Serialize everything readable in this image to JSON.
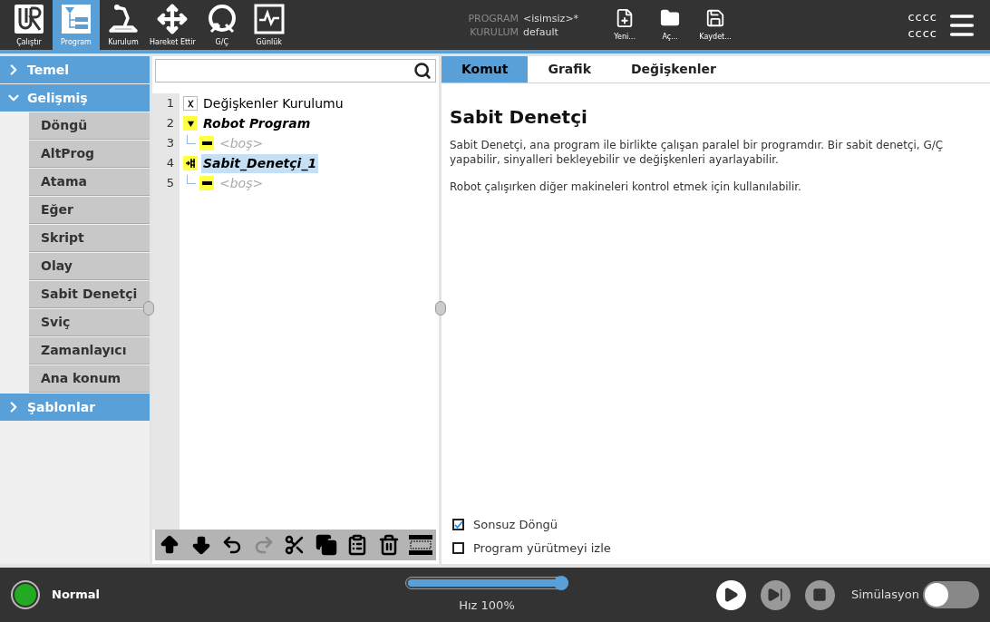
{
  "nav": [
    {
      "kind": "run",
      "label": "Çalıştır",
      "selected": false
    },
    {
      "kind": "program",
      "label": "Program",
      "selected": true
    },
    {
      "kind": "installation",
      "label": "Kurulum",
      "selected": false
    },
    {
      "kind": "move",
      "label": "Hareket Ettir",
      "selected": false
    },
    {
      "kind": "io",
      "label": "G/Ç",
      "selected": false
    },
    {
      "kind": "log",
      "label": "Günlük",
      "selected": false
    }
  ],
  "file_info": {
    "program_label": "PROGRAM",
    "program_value": "<isimsiz>*",
    "installation_label": "KURULUM",
    "installation_value": "default"
  },
  "file_actions": [
    {
      "kind": "new",
      "label": "Yeni..."
    },
    {
      "kind": "open",
      "label": "Aç..."
    },
    {
      "kind": "save",
      "label": "Kaydet..."
    }
  ],
  "user": {
    "line1": "cccc",
    "line2": "cccc"
  },
  "sidebar": [
    {
      "label": "Temel",
      "expanded": false
    },
    {
      "label": "Gelişmiş",
      "expanded": true,
      "children": [
        {
          "label": "Döngü"
        },
        {
          "label": "AltProg"
        },
        {
          "label": "Atama"
        },
        {
          "label": "Eğer"
        },
        {
          "label": "Skript"
        },
        {
          "label": "Olay"
        },
        {
          "label": "Sabit Denetçi"
        },
        {
          "label": "Sviç"
        },
        {
          "label": "Zamanlayıcı"
        },
        {
          "label": "Ana konum"
        }
      ]
    },
    {
      "label": "Şablonlar",
      "expanded": false
    }
  ],
  "tree": [
    {
      "line": "1",
      "kind": "variables",
      "label": "Değişkenler Kurulumu",
      "selected": false
    },
    {
      "line": "2",
      "kind": "program",
      "label": "Robot Program",
      "selected": false,
      "children": [
        {
          "line": "3",
          "kind": "empty",
          "label": "<boş>",
          "selected": false
        }
      ]
    },
    {
      "line": "4",
      "kind": "thread",
      "label": "Sabit_Denetçi_1",
      "selected": true,
      "children": [
        {
          "line": "5",
          "kind": "empty",
          "label": "<boş>",
          "selected": false
        }
      ]
    }
  ],
  "tree_toolbar": [
    {
      "kind": "up",
      "disabled": false
    },
    {
      "kind": "down",
      "disabled": false
    },
    {
      "kind": "undo",
      "disabled": false
    },
    {
      "kind": "redo",
      "disabled": true
    },
    {
      "kind": "cut",
      "disabled": false
    },
    {
      "kind": "copy",
      "disabled": false
    },
    {
      "kind": "paste",
      "disabled": false
    },
    {
      "kind": "delete",
      "disabled": false
    },
    {
      "kind": "suppress",
      "disabled": false
    }
  ],
  "tabs": [
    {
      "label": "Komut",
      "selected": true
    },
    {
      "label": "Grafik",
      "selected": false
    },
    {
      "label": "Değişkenler",
      "selected": false
    }
  ],
  "content": {
    "title": "Sabit Denetçi",
    "paragraphs": [
      "Sabit Denetçi, ana program ile birlikte çalışan paralel bir programdır. Bir sabit denetçi, G/Ç yapabilir, sinyalleri bekleyebilir ve değişkenleri ayarlayabilir.",
      "Robot çalışırken diğer makineleri kontrol etmek için kullanılabilir."
    ]
  },
  "options": [
    {
      "label": "Sonsuz Döngü",
      "checked": true
    },
    {
      "label": "Program yürütmeyi izle",
      "checked": false
    }
  ],
  "status": {
    "label": "Normal",
    "color": "#22aa22"
  },
  "speed": {
    "level": 1.0,
    "reading": "Hız 100%"
  },
  "controls": [
    {
      "kind": "play",
      "disabled": false
    },
    {
      "kind": "step",
      "disabled": true
    },
    {
      "kind": "stop",
      "disabled": true
    }
  ],
  "simulation": {
    "label": "Simülasyon",
    "on": false
  }
}
